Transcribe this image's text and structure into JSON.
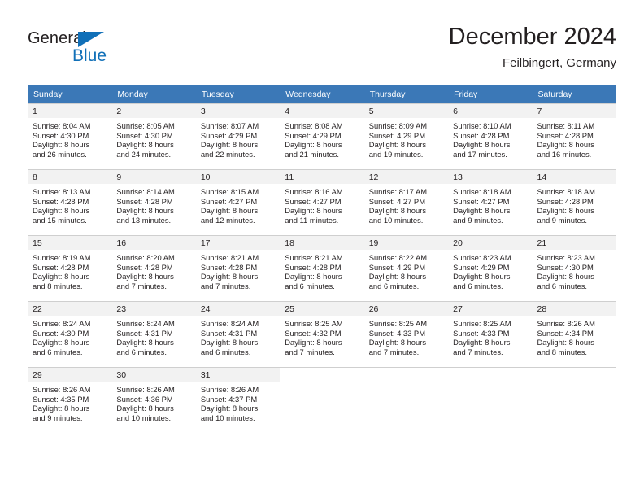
{
  "brand": {
    "name_part1": "General",
    "name_part2": "Blue",
    "triangle_icon": "blue-triangle-icon",
    "accent_color": "#1170b8"
  },
  "header": {
    "title": "December 2024",
    "subtitle": "Feilbingert, Germany"
  },
  "colors": {
    "header_row": "#3b78b7",
    "daynum_band": "#f2f2f2",
    "grid_line": "#cfcfcf",
    "text": "#231f20"
  },
  "weekdays": [
    "Sunday",
    "Monday",
    "Tuesday",
    "Wednesday",
    "Thursday",
    "Friday",
    "Saturday"
  ],
  "weeks": [
    [
      {
        "day": "1",
        "sunrise": "Sunrise: 8:04 AM",
        "sunset": "Sunset: 4:30 PM",
        "daylight_line1": "Daylight: 8 hours",
        "daylight_line2": "and 26 minutes."
      },
      {
        "day": "2",
        "sunrise": "Sunrise: 8:05 AM",
        "sunset": "Sunset: 4:30 PM",
        "daylight_line1": "Daylight: 8 hours",
        "daylight_line2": "and 24 minutes."
      },
      {
        "day": "3",
        "sunrise": "Sunrise: 8:07 AM",
        "sunset": "Sunset: 4:29 PM",
        "daylight_line1": "Daylight: 8 hours",
        "daylight_line2": "and 22 minutes."
      },
      {
        "day": "4",
        "sunrise": "Sunrise: 8:08 AM",
        "sunset": "Sunset: 4:29 PM",
        "daylight_line1": "Daylight: 8 hours",
        "daylight_line2": "and 21 minutes."
      },
      {
        "day": "5",
        "sunrise": "Sunrise: 8:09 AM",
        "sunset": "Sunset: 4:29 PM",
        "daylight_line1": "Daylight: 8 hours",
        "daylight_line2": "and 19 minutes."
      },
      {
        "day": "6",
        "sunrise": "Sunrise: 8:10 AM",
        "sunset": "Sunset: 4:28 PM",
        "daylight_line1": "Daylight: 8 hours",
        "daylight_line2": "and 17 minutes."
      },
      {
        "day": "7",
        "sunrise": "Sunrise: 8:11 AM",
        "sunset": "Sunset: 4:28 PM",
        "daylight_line1": "Daylight: 8 hours",
        "daylight_line2": "and 16 minutes."
      }
    ],
    [
      {
        "day": "8",
        "sunrise": "Sunrise: 8:13 AM",
        "sunset": "Sunset: 4:28 PM",
        "daylight_line1": "Daylight: 8 hours",
        "daylight_line2": "and 15 minutes."
      },
      {
        "day": "9",
        "sunrise": "Sunrise: 8:14 AM",
        "sunset": "Sunset: 4:28 PM",
        "daylight_line1": "Daylight: 8 hours",
        "daylight_line2": "and 13 minutes."
      },
      {
        "day": "10",
        "sunrise": "Sunrise: 8:15 AM",
        "sunset": "Sunset: 4:27 PM",
        "daylight_line1": "Daylight: 8 hours",
        "daylight_line2": "and 12 minutes."
      },
      {
        "day": "11",
        "sunrise": "Sunrise: 8:16 AM",
        "sunset": "Sunset: 4:27 PM",
        "daylight_line1": "Daylight: 8 hours",
        "daylight_line2": "and 11 minutes."
      },
      {
        "day": "12",
        "sunrise": "Sunrise: 8:17 AM",
        "sunset": "Sunset: 4:27 PM",
        "daylight_line1": "Daylight: 8 hours",
        "daylight_line2": "and 10 minutes."
      },
      {
        "day": "13",
        "sunrise": "Sunrise: 8:18 AM",
        "sunset": "Sunset: 4:27 PM",
        "daylight_line1": "Daylight: 8 hours",
        "daylight_line2": "and 9 minutes."
      },
      {
        "day": "14",
        "sunrise": "Sunrise: 8:18 AM",
        "sunset": "Sunset: 4:28 PM",
        "daylight_line1": "Daylight: 8 hours",
        "daylight_line2": "and 9 minutes."
      }
    ],
    [
      {
        "day": "15",
        "sunrise": "Sunrise: 8:19 AM",
        "sunset": "Sunset: 4:28 PM",
        "daylight_line1": "Daylight: 8 hours",
        "daylight_line2": "and 8 minutes."
      },
      {
        "day": "16",
        "sunrise": "Sunrise: 8:20 AM",
        "sunset": "Sunset: 4:28 PM",
        "daylight_line1": "Daylight: 8 hours",
        "daylight_line2": "and 7 minutes."
      },
      {
        "day": "17",
        "sunrise": "Sunrise: 8:21 AM",
        "sunset": "Sunset: 4:28 PM",
        "daylight_line1": "Daylight: 8 hours",
        "daylight_line2": "and 7 minutes."
      },
      {
        "day": "18",
        "sunrise": "Sunrise: 8:21 AM",
        "sunset": "Sunset: 4:28 PM",
        "daylight_line1": "Daylight: 8 hours",
        "daylight_line2": "and 6 minutes."
      },
      {
        "day": "19",
        "sunrise": "Sunrise: 8:22 AM",
        "sunset": "Sunset: 4:29 PM",
        "daylight_line1": "Daylight: 8 hours",
        "daylight_line2": "and 6 minutes."
      },
      {
        "day": "20",
        "sunrise": "Sunrise: 8:23 AM",
        "sunset": "Sunset: 4:29 PM",
        "daylight_line1": "Daylight: 8 hours",
        "daylight_line2": "and 6 minutes."
      },
      {
        "day": "21",
        "sunrise": "Sunrise: 8:23 AM",
        "sunset": "Sunset: 4:30 PM",
        "daylight_line1": "Daylight: 8 hours",
        "daylight_line2": "and 6 minutes."
      }
    ],
    [
      {
        "day": "22",
        "sunrise": "Sunrise: 8:24 AM",
        "sunset": "Sunset: 4:30 PM",
        "daylight_line1": "Daylight: 8 hours",
        "daylight_line2": "and 6 minutes."
      },
      {
        "day": "23",
        "sunrise": "Sunrise: 8:24 AM",
        "sunset": "Sunset: 4:31 PM",
        "daylight_line1": "Daylight: 8 hours",
        "daylight_line2": "and 6 minutes."
      },
      {
        "day": "24",
        "sunrise": "Sunrise: 8:24 AM",
        "sunset": "Sunset: 4:31 PM",
        "daylight_line1": "Daylight: 8 hours",
        "daylight_line2": "and 6 minutes."
      },
      {
        "day": "25",
        "sunrise": "Sunrise: 8:25 AM",
        "sunset": "Sunset: 4:32 PM",
        "daylight_line1": "Daylight: 8 hours",
        "daylight_line2": "and 7 minutes."
      },
      {
        "day": "26",
        "sunrise": "Sunrise: 8:25 AM",
        "sunset": "Sunset: 4:33 PM",
        "daylight_line1": "Daylight: 8 hours",
        "daylight_line2": "and 7 minutes."
      },
      {
        "day": "27",
        "sunrise": "Sunrise: 8:25 AM",
        "sunset": "Sunset: 4:33 PM",
        "daylight_line1": "Daylight: 8 hours",
        "daylight_line2": "and 7 minutes."
      },
      {
        "day": "28",
        "sunrise": "Sunrise: 8:26 AM",
        "sunset": "Sunset: 4:34 PM",
        "daylight_line1": "Daylight: 8 hours",
        "daylight_line2": "and 8 minutes."
      }
    ],
    [
      {
        "day": "29",
        "sunrise": "Sunrise: 8:26 AM",
        "sunset": "Sunset: 4:35 PM",
        "daylight_line1": "Daylight: 8 hours",
        "daylight_line2": "and 9 minutes."
      },
      {
        "day": "30",
        "sunrise": "Sunrise: 8:26 AM",
        "sunset": "Sunset: 4:36 PM",
        "daylight_line1": "Daylight: 8 hours",
        "daylight_line2": "and 10 minutes."
      },
      {
        "day": "31",
        "sunrise": "Sunrise: 8:26 AM",
        "sunset": "Sunset: 4:37 PM",
        "daylight_line1": "Daylight: 8 hours",
        "daylight_line2": "and 10 minutes."
      },
      {
        "day": "",
        "sunrise": "",
        "sunset": "",
        "daylight_line1": "",
        "daylight_line2": ""
      },
      {
        "day": "",
        "sunrise": "",
        "sunset": "",
        "daylight_line1": "",
        "daylight_line2": ""
      },
      {
        "day": "",
        "sunrise": "",
        "sunset": "",
        "daylight_line1": "",
        "daylight_line2": ""
      },
      {
        "day": "",
        "sunrise": "",
        "sunset": "",
        "daylight_line1": "",
        "daylight_line2": ""
      }
    ]
  ]
}
